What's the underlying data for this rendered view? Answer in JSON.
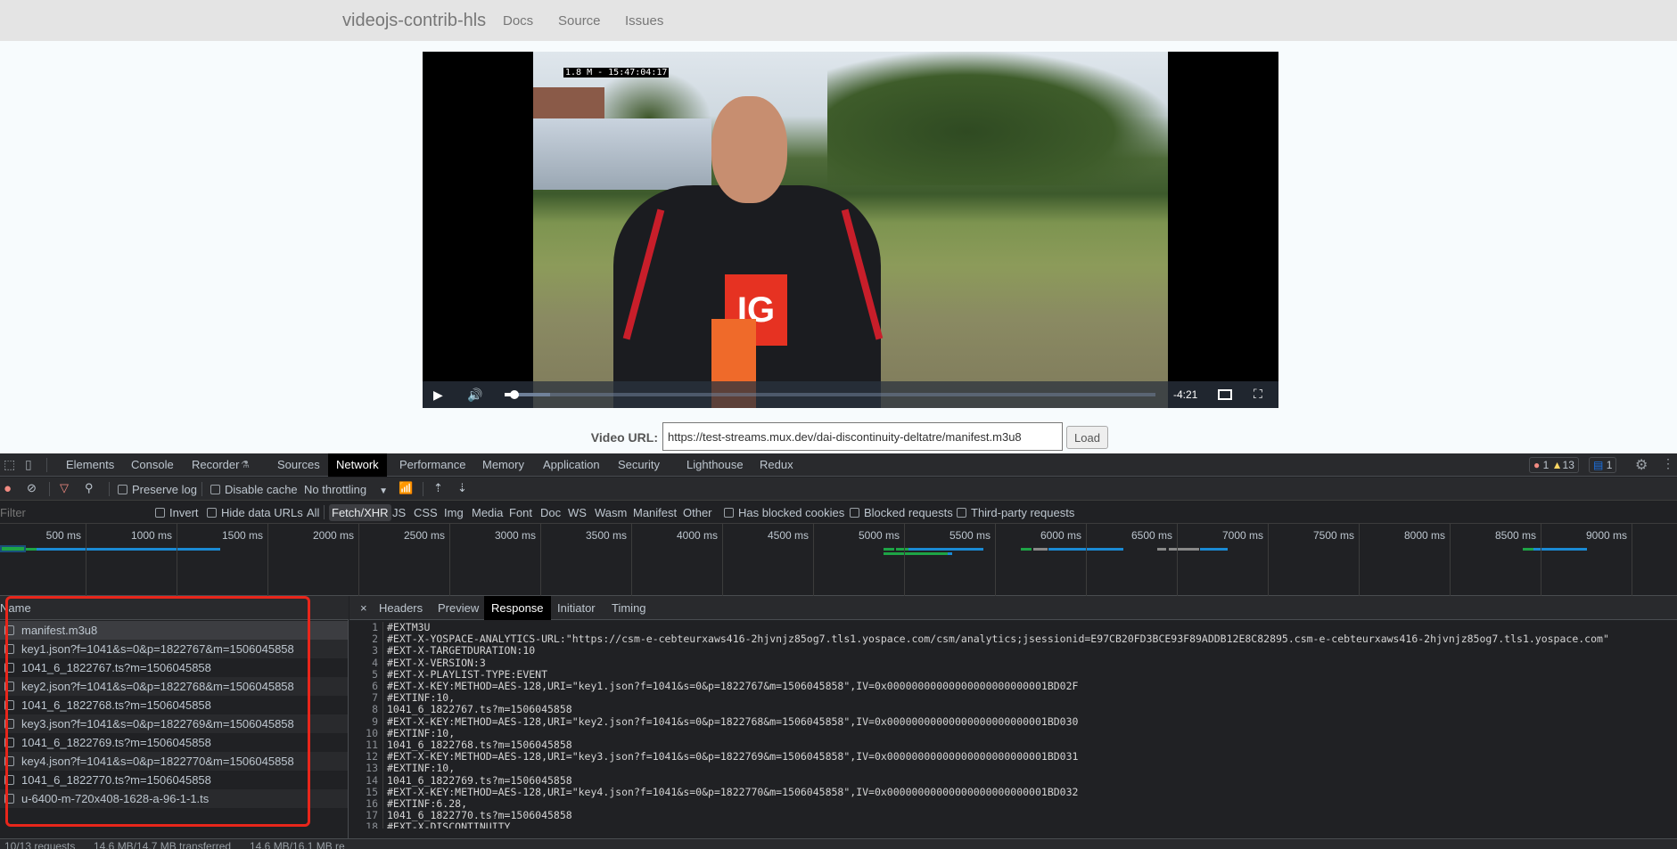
{
  "nav": {
    "brand": "videojs-contrib-hls",
    "links": [
      "Docs",
      "Source",
      "Issues"
    ]
  },
  "player": {
    "overlay_timestamp": "1.8 M - 15:47:04:17",
    "jersey_logo": "IG",
    "remaining_time": "-4:21",
    "progress_percent": 1.5,
    "buffered_percent": 7
  },
  "url_form": {
    "label": "Video URL:",
    "value": "https://test-streams.mux.dev/dai-discontinuity-deltatre/manifest.m3u8",
    "button": "Load"
  },
  "devtools": {
    "tabs": [
      "Elements",
      "Console",
      "Recorder",
      "Sources",
      "Network",
      "Performance",
      "Memory",
      "Application",
      "Security",
      "Lighthouse",
      "Redux"
    ],
    "active_tab": "Network",
    "badges": {
      "errors": "1",
      "warnings": "13",
      "messages": "1"
    },
    "toolbar": {
      "preserve_log": "Preserve log",
      "disable_cache": "Disable cache",
      "throttling": "No throttling"
    },
    "filter": {
      "placeholder": "Filter",
      "invert": "Invert",
      "hide_data_urls": "Hide data URLs",
      "types": [
        "All",
        "Fetch/XHR",
        "JS",
        "CSS",
        "Img",
        "Media",
        "Font",
        "Doc",
        "WS",
        "Wasm",
        "Manifest",
        "Other"
      ],
      "active_type": "Fetch/XHR",
      "has_blocked_cookies": "Has blocked cookies",
      "blocked_requests": "Blocked requests",
      "third_party": "Third-party requests"
    },
    "timeline_ticks": [
      "500 ms",
      "1000 ms",
      "1500 ms",
      "2000 ms",
      "2500 ms",
      "3000 ms",
      "3500 ms",
      "4000 ms",
      "4500 ms",
      "5000 ms",
      "5500 ms",
      "6000 ms",
      "6500 ms",
      "7000 ms",
      "7500 ms",
      "8000 ms",
      "8500 ms",
      "9000 ms"
    ],
    "name_header": "Name",
    "requests": [
      "manifest.m3u8",
      "key1.json?f=1041&s=0&p=1822767&m=1506045858",
      "1041_6_1822767.ts?m=1506045858",
      "key2.json?f=1041&s=0&p=1822768&m=1506045858",
      "1041_6_1822768.ts?m=1506045858",
      "key3.json?f=1041&s=0&p=1822769&m=1506045858",
      "1041_6_1822769.ts?m=1506045858",
      "key4.json?f=1041&s=0&p=1822770&m=1506045858",
      "1041_6_1822770.ts?m=1506045858",
      "u-6400-m-720x408-1628-a-96-1-1.ts"
    ],
    "detail_tabs": [
      "Headers",
      "Preview",
      "Response",
      "Initiator",
      "Timing"
    ],
    "active_detail_tab": "Response",
    "response_lines": [
      "#EXTM3U",
      "#EXT-X-YOSPACE-ANALYTICS-URL:\"https://csm-e-cebteurxaws416-2hjvnjz85og7.tls1.yospace.com/csm/analytics;jsessionid=E97CB20FD3BCE93F89ADDB12E8C82895.csm-e-cebteurxaws416-2hjvnjz85og7.tls1.yospace.com\"",
      "#EXT-X-TARGETDURATION:10",
      "#EXT-X-VERSION:3",
      "#EXT-X-PLAYLIST-TYPE:EVENT",
      "#EXT-X-KEY:METHOD=AES-128,URI=\"key1.json?f=1041&s=0&p=1822767&m=1506045858\",IV=0x00000000000000000000000001BD02F",
      "#EXTINF:10,",
      "1041_6_1822767.ts?m=1506045858",
      "#EXT-X-KEY:METHOD=AES-128,URI=\"key2.json?f=1041&s=0&p=1822768&m=1506045858\",IV=0x00000000000000000000000001BD030",
      "#EXTINF:10,",
      "1041_6_1822768.ts?m=1506045858",
      "#EXT-X-KEY:METHOD=AES-128,URI=\"key3.json?f=1041&s=0&p=1822769&m=1506045858\",IV=0x00000000000000000000000001BD031",
      "#EXTINF:10,",
      "1041_6_1822769.ts?m=1506045858",
      "#EXT-X-KEY:METHOD=AES-128,URI=\"key4.json?f=1041&s=0&p=1822770&m=1506045858\",IV=0x00000000000000000000000001BD032",
      "#EXTINF:6.28,",
      "1041_6_1822770.ts?m=1506045858",
      "#EXT-X-DISCONTINUITY"
    ],
    "status": {
      "requests": "10/13 requests",
      "transferred": "14.6 MB/14.7 MB transferred",
      "resources": "14.6 MB/16.1 MB re"
    }
  },
  "colors": {
    "highlight_box": "#e8261b",
    "record": "#f28b82",
    "active_tab_bg": "#000000",
    "waterfall_blue": "#1a8ad4",
    "waterfall_green": "#1ea446"
  }
}
